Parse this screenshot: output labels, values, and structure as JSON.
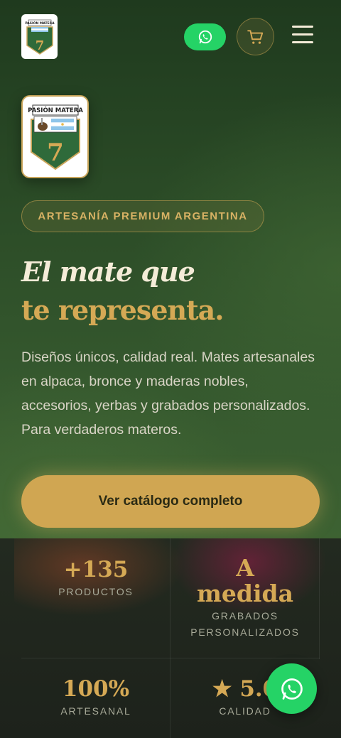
{
  "header": {
    "logo_text": "PASIÓN MATERA",
    "logo_number": "7"
  },
  "hero": {
    "logo_text": "PASIÓN MATERA",
    "logo_number": "7",
    "badge": "ARTESANÍA PREMIUM ARGENTINA",
    "headline_line1": "El mate que",
    "headline_line2": "te representa.",
    "description": "Diseños únicos, calidad real. Mates artesanales en alpaca, bronce y maderas nobles, accesorios, yerbas y grabados personalizados. Para verdaderos materos.",
    "cta_label": "Ver catálogo completo"
  },
  "stats": [
    {
      "value": "+135",
      "label": "PRODUCTOS"
    },
    {
      "value_line1": "A",
      "value_line2": "medida",
      "label_line1": "GRABADOS",
      "label_line2": "PERSONALIZADOS"
    },
    {
      "value": "100%",
      "label": "ARTESANAL"
    },
    {
      "value": "★ 5.0",
      "label": "CALIDAD"
    }
  ],
  "colors": {
    "accent_gold": "#d0a652",
    "hero_green": "#2a4a26",
    "whatsapp_green": "#25d366"
  },
  "icons": [
    "whatsapp-icon",
    "cart-icon",
    "menu-icon",
    "logo-badge-icon"
  ]
}
